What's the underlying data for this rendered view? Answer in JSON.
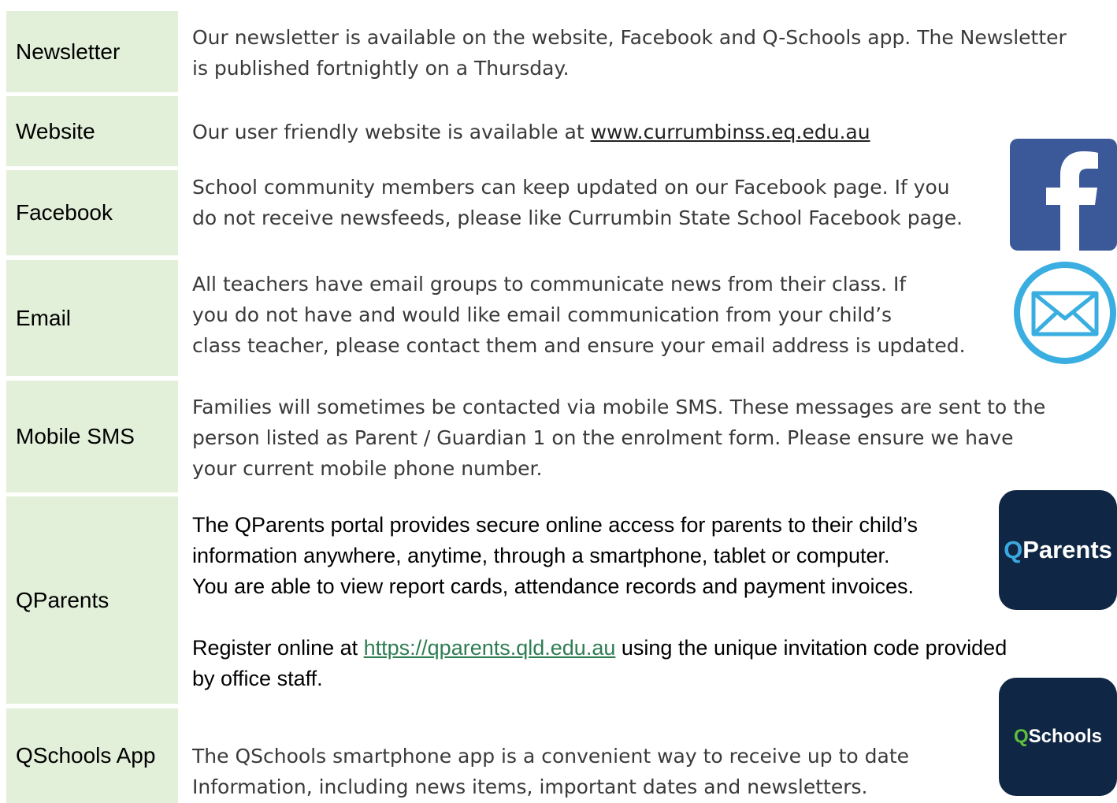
{
  "rows": {
    "newsletter": {
      "label": "Newsletter",
      "line1": "Our newsletter is available on the website, Facebook and Q-Schools app. The Newsletter",
      "line2": "is published fortnightly on a Thursday."
    },
    "website": {
      "label": "Website",
      "text": "Our user friendly website is available at ",
      "link": "www.currumbinss.eq.edu.au"
    },
    "facebook": {
      "label": "Facebook",
      "line1": "School community members can keep updated on our Facebook page.  If you",
      "line2": "do not receive newsfeeds, please like Currumbin State School Facebook page."
    },
    "email": {
      "label": "Email",
      "line1": "All teachers have email groups to communicate news from their class.  If",
      "line2": "you do not have and would like email communication from your child’s",
      "line3": "class teacher, please contact them and ensure your email address is updated."
    },
    "sms": {
      "label": "Mobile SMS",
      "line1": "Families will sometimes be contacted via mobile SMS.  These messages are sent to the",
      "line2": "person listed as Parent / Guardian 1 on the enrolment form. Please ensure we have",
      "line3": "your current mobile phone number."
    },
    "qparents": {
      "label": "QParents",
      "line1": "The QParents portal provides secure online access for parents to their child’s",
      "line2": "information anywhere, anytime, through a smartphone, tablet or computer.",
      "line3": "You are able to view report cards, attendance records and payment invoices.",
      "reg_prefix": "Register online at ",
      "reg_link": "https://qparents.qld.edu.au",
      "reg_suffix": " using the unique invitation code provided",
      "reg_line2": "by office staff."
    },
    "qschools": {
      "label": "QSchools App",
      "line1": "The QSchools smartphone app is a convenient way to receive up to date",
      "line2": "Information, including news items, important dates and newsletters."
    }
  },
  "logos": {
    "qparents_q": "Q",
    "qparents_rest": "Parents",
    "qschools_q": "Q",
    "qschools_rest": "Schools"
  },
  "colors": {
    "label_bg": "#e2efd9",
    "facebook_blue": "#3b5998",
    "email_blue": "#3aaee0",
    "app_navy": "#0f2744",
    "link_green": "#2e7d52"
  },
  "icons": [
    "facebook-icon",
    "email-icon",
    "qparents-logo",
    "qschools-logo"
  ]
}
